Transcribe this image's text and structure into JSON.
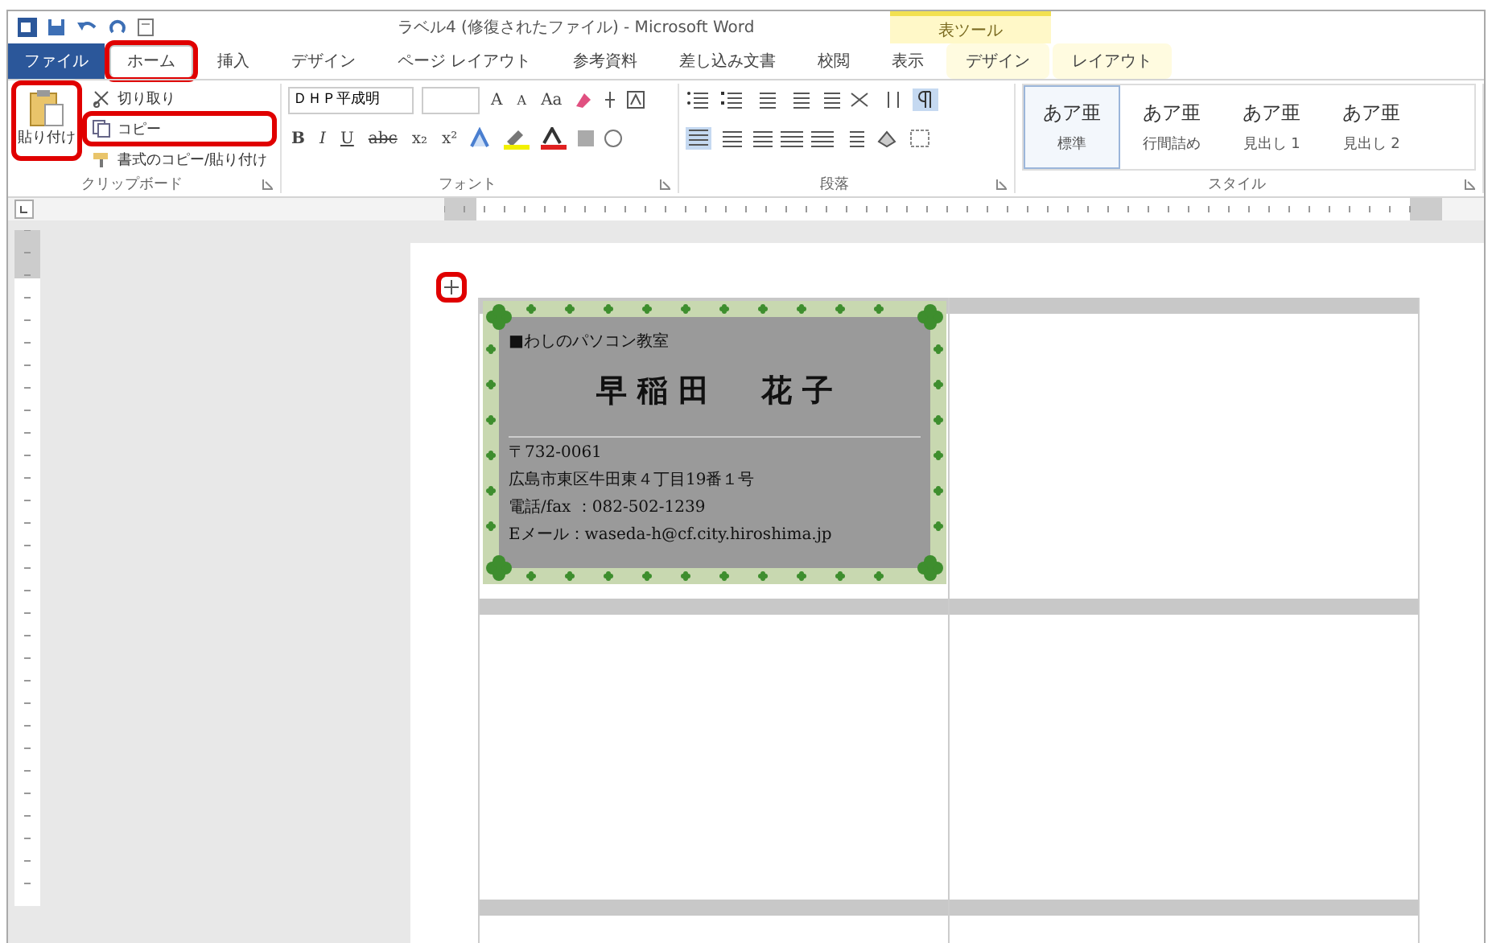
{
  "window": {
    "title": "ラベル4 (修復されたファイル) - Microsoft Word",
    "context_tab_group": "表ツール"
  },
  "tabs": [
    {
      "label": "ファイル",
      "kind": "file",
      "selected": false,
      "highlighted": false
    },
    {
      "label": "ホーム",
      "kind": "normal",
      "selected": true,
      "highlighted": true
    },
    {
      "label": "挿入",
      "kind": "normal",
      "selected": false,
      "highlighted": false
    },
    {
      "label": "デザイン",
      "kind": "normal",
      "selected": false,
      "highlighted": false
    },
    {
      "label": "ページ レイアウト",
      "kind": "normal",
      "selected": false,
      "highlighted": false
    },
    {
      "label": "参考資料",
      "kind": "normal",
      "selected": false,
      "highlighted": false
    },
    {
      "label": "差し込み文書",
      "kind": "normal",
      "selected": false,
      "highlighted": false
    },
    {
      "label": "校閲",
      "kind": "normal",
      "selected": false,
      "highlighted": false
    },
    {
      "label": "表示",
      "kind": "normal",
      "selected": false,
      "highlighted": false
    },
    {
      "label": "デザイン",
      "kind": "context",
      "selected": false,
      "highlighted": false
    },
    {
      "label": "レイアウト",
      "kind": "context",
      "selected": false,
      "highlighted": false
    }
  ],
  "clipboard": {
    "paste": {
      "label": "貼り付け",
      "highlighted": true
    },
    "items": [
      {
        "label": "切り取り",
        "kind": "cut",
        "highlighted": false
      },
      {
        "label": "コピー",
        "kind": "copy",
        "highlighted": true
      },
      {
        "label": "書式のコピー/貼り付け",
        "kind": "brush",
        "highlighted": false
      }
    ],
    "group_label": "クリップボード"
  },
  "font": {
    "font_name": "ＤＨＰ平成明",
    "row1": [
      "A",
      "A",
      "Aa"
    ],
    "row2": [
      "B",
      "I",
      "U",
      "abc",
      "x₂",
      "x²"
    ],
    "group_label": "フォント"
  },
  "paragraph": {
    "group_label": "段落"
  },
  "styles": {
    "items": [
      {
        "sample": "あア亜",
        "label": "標準",
        "selected": true
      },
      {
        "sample": "あア亜",
        "label": "行間詰め",
        "selected": false
      },
      {
        "sample": "あア亜",
        "label": "見出し 1",
        "selected": false
      },
      {
        "sample": "あア亜",
        "label": "見出し 2",
        "selected": false
      }
    ],
    "group_label": "スタイル"
  },
  "table_handle": {
    "highlighted": true
  },
  "card": {
    "header": "■わしのパソコン教室",
    "name": "早 稲 田 　 花 子",
    "postal": "〒732-0061",
    "address": "広島市東区牛田東４丁目19番１号",
    "phone": "電話/fax ：082-502-1239",
    "email": "Eメール：waseda-h@cf.city.hiroshima.jp"
  }
}
